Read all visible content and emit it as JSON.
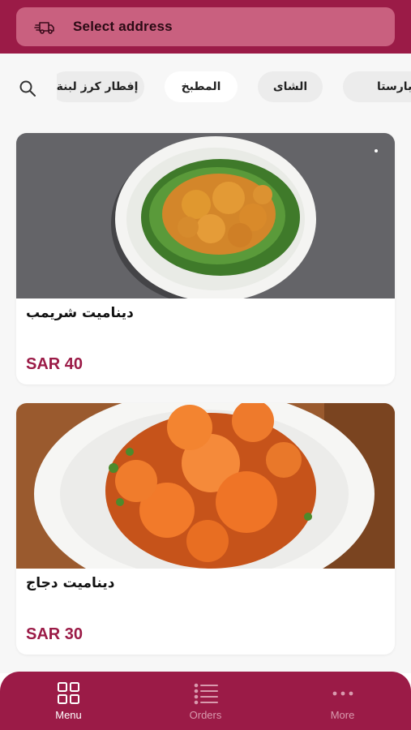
{
  "header": {
    "address_label": "Select address",
    "icon": "delivery-truck-icon"
  },
  "categories": {
    "search_icon": "search-icon",
    "items": [
      {
        "label": "إفطار كرز لبنة",
        "active": false
      },
      {
        "label": "المطبخ",
        "active": true
      },
      {
        "label": "الشاى",
        "active": false
      },
      {
        "label": "- بارستا",
        "active": false
      }
    ]
  },
  "products": [
    {
      "name": "ديناميت شريمب",
      "price": "SAR 40"
    },
    {
      "name": "ديناميت دجاج",
      "price": "SAR 30"
    }
  ],
  "bottom_nav": {
    "items": [
      {
        "label": "Menu",
        "icon": "grid-icon",
        "active": true
      },
      {
        "label": "Orders",
        "icon": "list-icon",
        "active": false
      },
      {
        "label": "More",
        "icon": "more-dots-icon",
        "active": false
      }
    ]
  },
  "colors": {
    "brand": "#9b1b47",
    "address_bar": "#c9607f",
    "nav_active": "#ffffff",
    "nav_inactive": "#d99aae"
  }
}
